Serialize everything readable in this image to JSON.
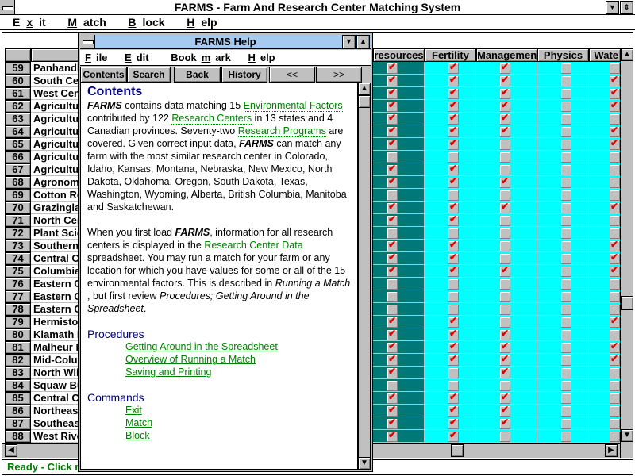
{
  "app": {
    "title": "FARMS - Farm And Research Center Matching System",
    "menu": [
      {
        "pre": "E",
        "ul": "x",
        "post": "it"
      },
      {
        "pre": "",
        "ul": "M",
        "post": "atch"
      },
      {
        "pre": "",
        "ul": "B",
        "post": "lock"
      },
      {
        "pre": "",
        "ul": "H",
        "post": "elp"
      }
    ],
    "min_icon": "▼",
    "restore_icon": "⇕"
  },
  "sheet": {
    "columns": [
      "resources",
      "Fertility",
      "Management",
      "Physics",
      "Wate"
    ],
    "colors": {
      "first_col": "#007878",
      "other_cols": "#00ffff",
      "check": "#e00000"
    },
    "rows": [
      {
        "n": "59",
        "name": "Panhandle",
        "checks": [
          1,
          1,
          1,
          0,
          0
        ]
      },
      {
        "n": "60",
        "name": "South Cen",
        "checks": [
          1,
          1,
          1,
          0,
          1
        ]
      },
      {
        "n": "61",
        "name": "West Cent",
        "checks": [
          1,
          1,
          1,
          0,
          1
        ]
      },
      {
        "n": "62",
        "name": "Agricultura",
        "checks": [
          1,
          1,
          1,
          0,
          1
        ]
      },
      {
        "n": "63",
        "name": "Agricultura",
        "checks": [
          1,
          1,
          1,
          0,
          0
        ]
      },
      {
        "n": "64",
        "name": "Agricultura",
        "checks": [
          1,
          1,
          1,
          0,
          1
        ]
      },
      {
        "n": "65",
        "name": "Agricultura",
        "checks": [
          1,
          1,
          0,
          0,
          1
        ]
      },
      {
        "n": "66",
        "name": "Agricultura",
        "checks": [
          0,
          0,
          0,
          0,
          0
        ]
      },
      {
        "n": "67",
        "name": "Agricultura",
        "checks": [
          1,
          1,
          0,
          0,
          0
        ]
      },
      {
        "n": "68",
        "name": "Agronomy",
        "checks": [
          1,
          1,
          1,
          0,
          0
        ]
      },
      {
        "n": "69",
        "name": "Cotton Re",
        "checks": [
          0,
          0,
          0,
          0,
          0
        ]
      },
      {
        "n": "70",
        "name": "Grazinglar",
        "checks": [
          1,
          1,
          1,
          0,
          1
        ]
      },
      {
        "n": "71",
        "name": "North Cen",
        "checks": [
          1,
          1,
          0,
          0,
          0
        ]
      },
      {
        "n": "72",
        "name": "Plant Scie",
        "checks": [
          0,
          0,
          0,
          0,
          0
        ]
      },
      {
        "n": "73",
        "name": "Southern I",
        "checks": [
          1,
          1,
          0,
          0,
          1
        ]
      },
      {
        "n": "74",
        "name": "Central Or",
        "checks": [
          1,
          1,
          0,
          0,
          1
        ]
      },
      {
        "n": "75",
        "name": "Columbia I",
        "checks": [
          1,
          1,
          1,
          0,
          1
        ]
      },
      {
        "n": "76",
        "name": "Eastern O",
        "checks": [
          0,
          0,
          0,
          0,
          0
        ]
      },
      {
        "n": "77",
        "name": "Eastern O",
        "checks": [
          0,
          0,
          0,
          0,
          0
        ]
      },
      {
        "n": "78",
        "name": "Eastern O",
        "checks": [
          0,
          0,
          0,
          0,
          0
        ]
      },
      {
        "n": "79",
        "name": "Hermiston",
        "checks": [
          1,
          1,
          0,
          0,
          1
        ]
      },
      {
        "n": "80",
        "name": "Klamath E",
        "checks": [
          1,
          1,
          1,
          0,
          0
        ]
      },
      {
        "n": "81",
        "name": "Malheur E",
        "checks": [
          1,
          1,
          1,
          0,
          1
        ]
      },
      {
        "n": "82",
        "name": "Mid-Colum",
        "checks": [
          1,
          1,
          1,
          0,
          1
        ]
      },
      {
        "n": "83",
        "name": "North Will",
        "checks": [
          1,
          0,
          1,
          0,
          0
        ]
      },
      {
        "n": "84",
        "name": "Squaw Bu",
        "checks": [
          0,
          0,
          0,
          0,
          0
        ]
      },
      {
        "n": "85",
        "name": "Central Cr",
        "checks": [
          1,
          1,
          1,
          0,
          0
        ]
      },
      {
        "n": "86",
        "name": "Northeast",
        "checks": [
          1,
          1,
          1,
          0,
          0
        ]
      },
      {
        "n": "87",
        "name": "Southeast",
        "checks": [
          1,
          1,
          1,
          0,
          0
        ]
      },
      {
        "n": "88",
        "name": "West Rive",
        "checks": [
          1,
          1,
          0,
          0,
          0
        ]
      }
    ]
  },
  "status": {
    "text": "Ready - Click ri"
  },
  "help": {
    "title": "FARMS Help",
    "menu": [
      {
        "pre": "",
        "ul": "F",
        "post": "ile"
      },
      {
        "pre": "",
        "ul": "E",
        "post": "dit"
      },
      {
        "pre": "Book",
        "ul": "m",
        "post": "ark"
      },
      {
        "pre": "",
        "ul": "H",
        "post": "elp"
      }
    ],
    "buttons": [
      "Contents",
      "Search",
      "Back",
      "History",
      "<<",
      ">>"
    ],
    "heading": "Contents",
    "p1": {
      "b1": "FARMS",
      "t1": " contains data matching 15 ",
      "l1": "Environmental Factors",
      "t2": " contributed by 122 ",
      "l2": "Research Centers",
      "t3": " in 13 states and 4 Canadian provinces. Seventy-two ",
      "l3": "Research Programs",
      "t4": " are covered. Given correct input data, ",
      "b2": "FARMS",
      "t5": " can match any farm with the most similar research center in Colorado, Idaho, Kansas, Montana, Nebraska, New Mexico, North Dakota, Oklahoma, Oregon, South Dakota, Texas, Washington, Wyoming, Alberta, British Columbia, Manitoba and Saskatchewan."
    },
    "p2": {
      "t1": "When you first load ",
      "b1": "FARMS",
      "t2": ", information for all research centers is displayed in the ",
      "l1": "Research Center Data",
      "t3": " spreadsheet. You may run a match for your farm or any location for which you have values for some or all of the 15 environmental factors. This is described in ",
      "i1": "Running a Match",
      "t4": " , but first review ",
      "i2": "Procedures; Getting Around in the Spreadsheet",
      "t5": "."
    },
    "procedures": {
      "title": "Procedures",
      "links": [
        "Getting Around in the Spreadsheet",
        "Overview of Running a Match",
        "Saving and Printing"
      ]
    },
    "commands": {
      "title": "Commands",
      "links": [
        "Exit",
        "Match",
        "Block"
      ]
    }
  }
}
